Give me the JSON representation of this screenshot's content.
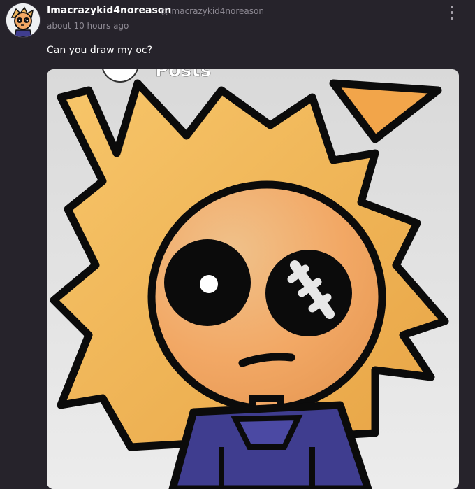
{
  "post": {
    "username": "Imacrazykid4noreason",
    "handle": "@Imacrazykid4noreason",
    "timestamp": "about 10 hours ago",
    "text": "Can you draw my oc?",
    "image_caption_partial": "Posts"
  },
  "icons": {
    "menu": "more-vertical-icon"
  },
  "colors": {
    "background": "#26232b",
    "hair": "#f0b65e",
    "face": "#f2a865",
    "shirt": "#3f3d8f",
    "outline": "#0a0a0a"
  }
}
